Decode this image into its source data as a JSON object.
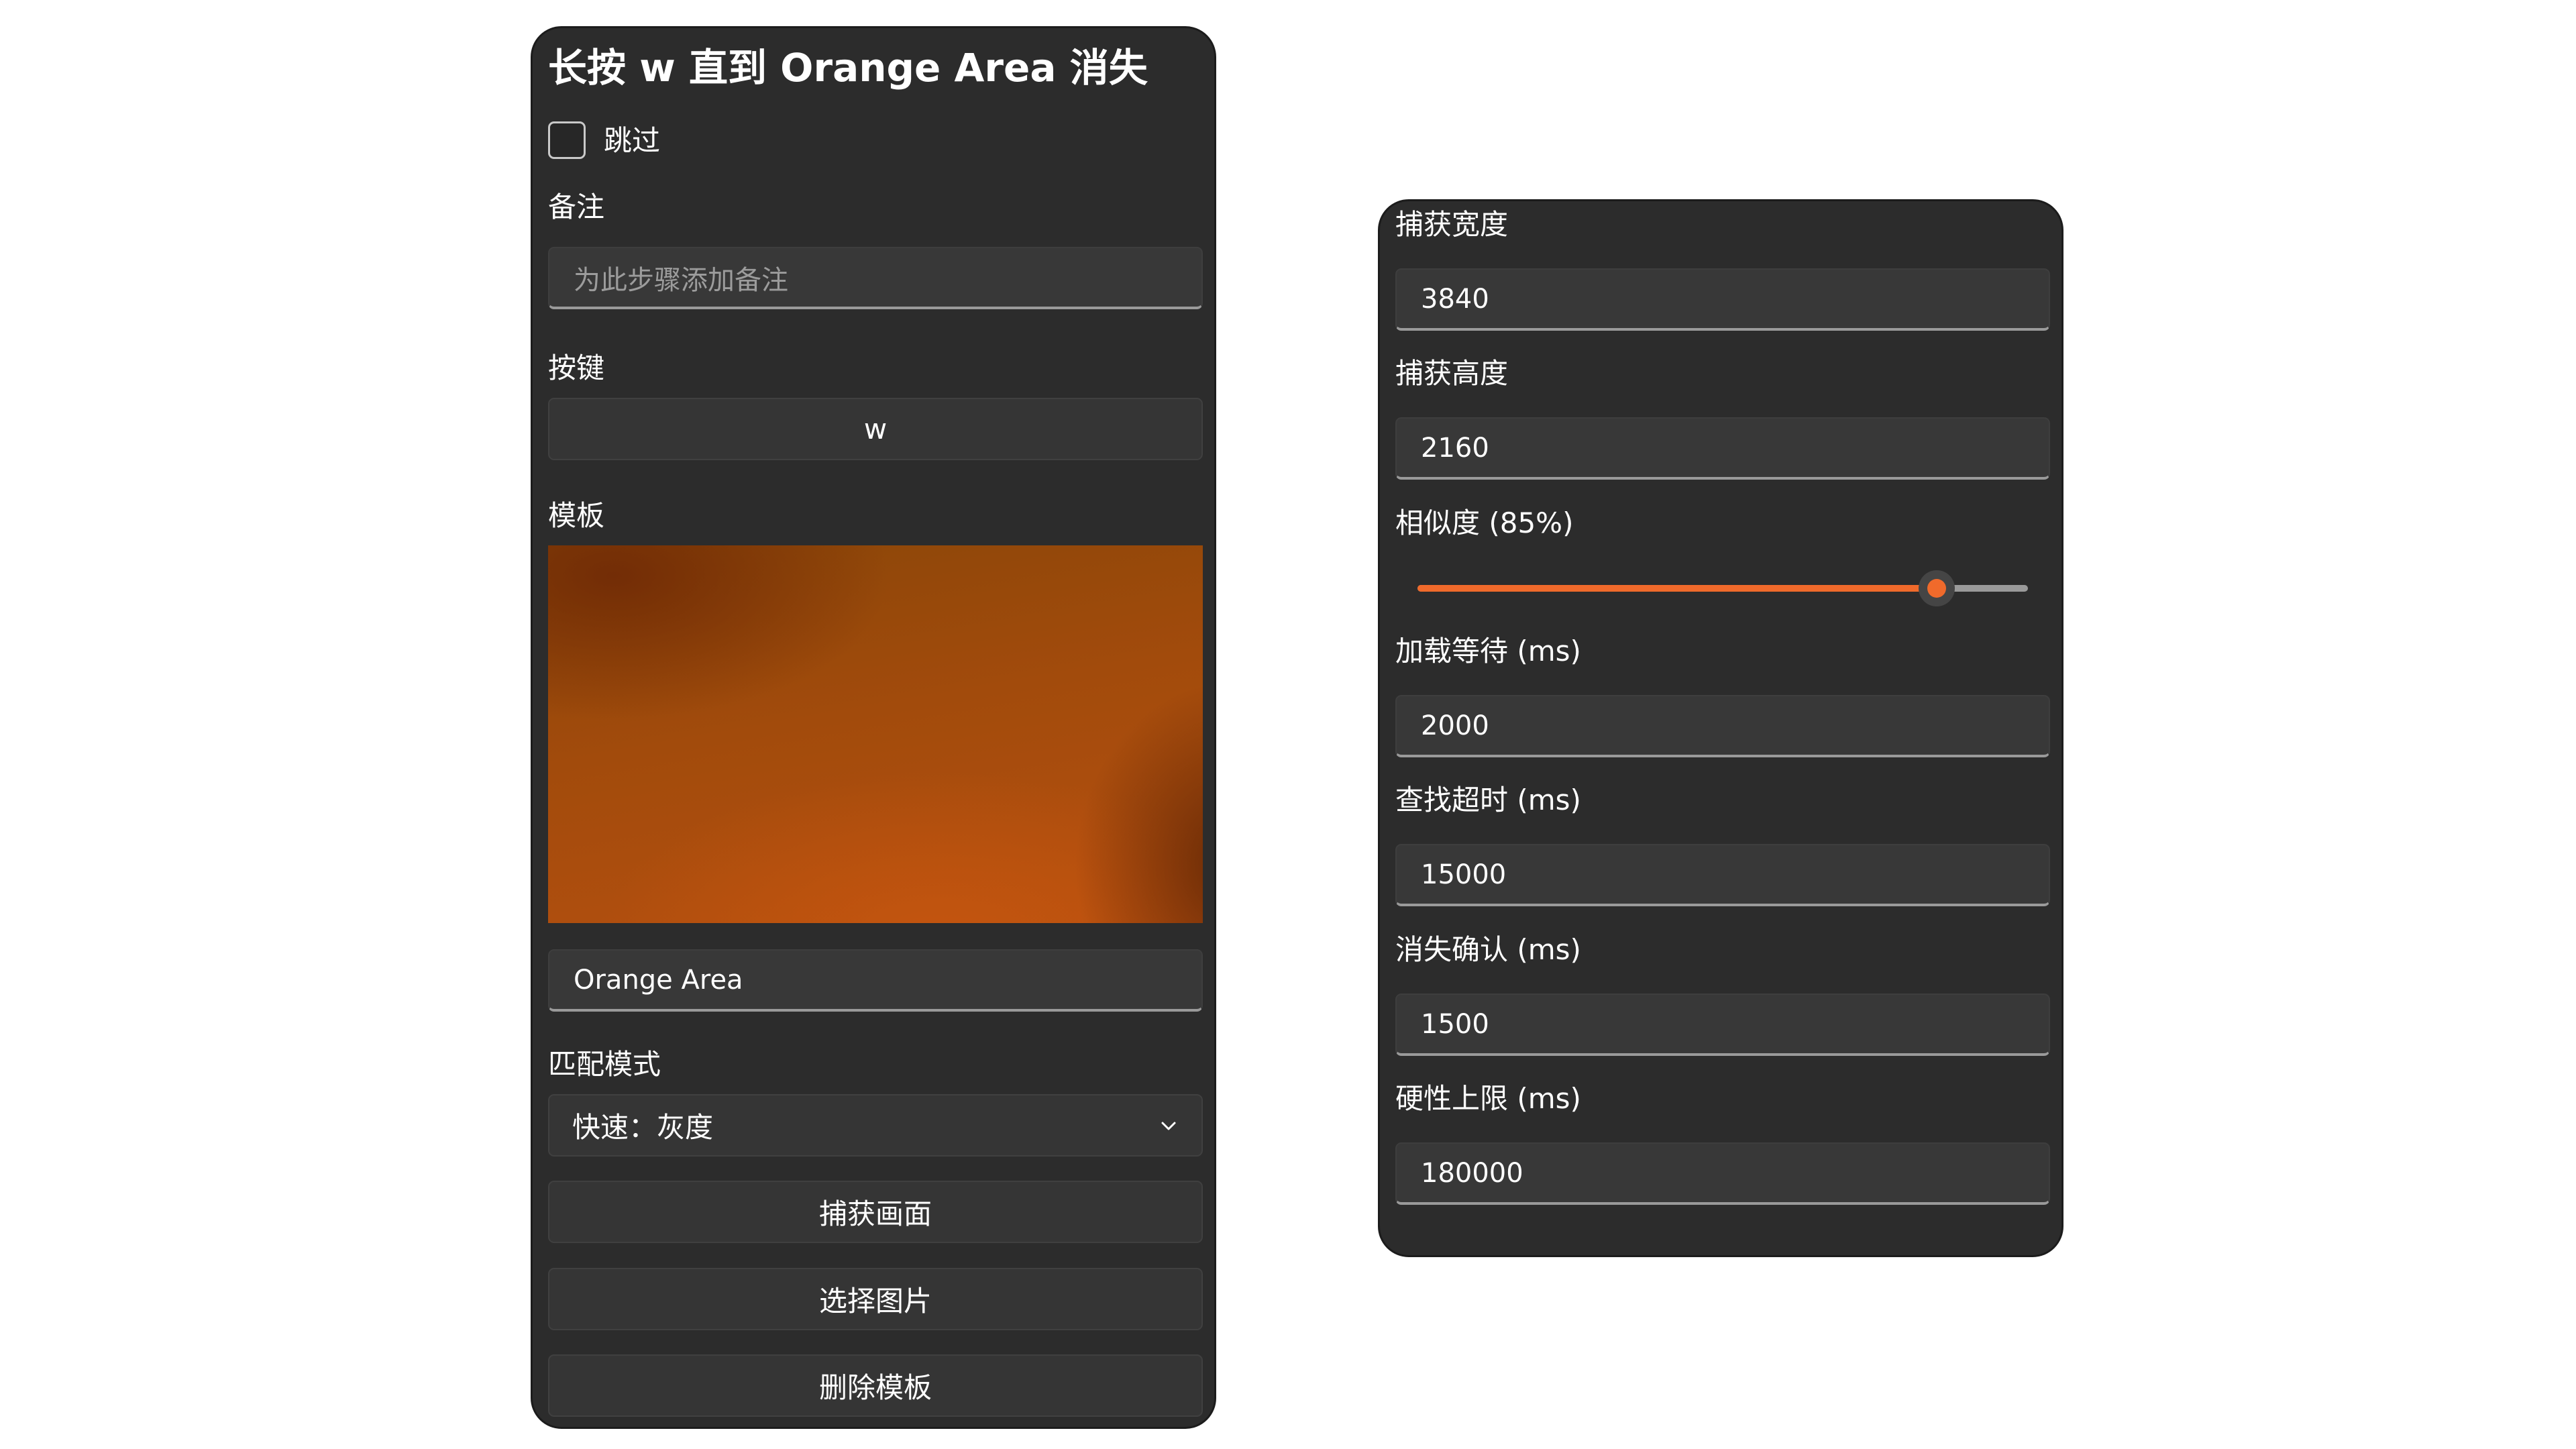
{
  "left_panel": {
    "title": "长按 w 直到 Orange Area 消失",
    "skip_label": "跳过",
    "skip_checked": false,
    "note_label": "备注",
    "note_placeholder": "为此步骤添加备注",
    "note_value": "",
    "key_label": "按键",
    "key_value": "w",
    "template_label": "模板",
    "template_name": "Orange Area",
    "match_mode_label": "匹配模式",
    "match_mode_value": "快速：灰度",
    "capture_button": "捕获画面",
    "select_image_button": "选择图片",
    "delete_template_button": "删除模板"
  },
  "right_panel": {
    "capture_width_label": "捕获宽度",
    "capture_width_value": "3840",
    "capture_height_label": "捕获高度",
    "capture_height_value": "2160",
    "similarity_label": "相似度 (85%)",
    "similarity_value": 0.85,
    "load_wait_label": "加载等待 (ms)",
    "load_wait_value": "2000",
    "find_timeout_label": "查找超时 (ms)",
    "find_timeout_value": "15000",
    "disappear_confirm_label": "消失确认 (ms)",
    "disappear_confirm_value": "1500",
    "hard_limit_label": "硬性上限 (ms)",
    "hard_limit_value": "180000"
  },
  "colors": {
    "accent": "#f06a2b",
    "panel_bg": "#2c2c2c",
    "field_bg": "#383838"
  }
}
